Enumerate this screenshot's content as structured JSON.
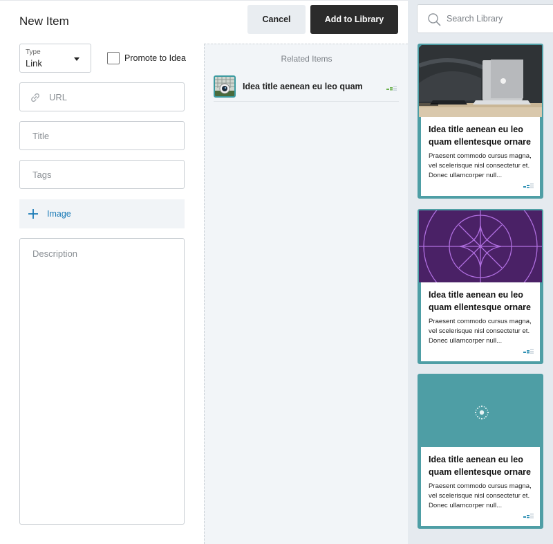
{
  "form": {
    "title": "New Item",
    "type_label": "Type",
    "type_value": "Link",
    "promote_label": "Promote to Idea",
    "promote_checked": false,
    "url_placeholder": "URL",
    "title_placeholder": "Title",
    "tags_placeholder": "Tags",
    "image_label": "Image",
    "description_placeholder": "Description"
  },
  "header": {
    "cancel_label": "Cancel",
    "add_label": "Add to Library"
  },
  "related": {
    "heading": "Related Items",
    "items": [
      {
        "title": "Idea title aenean eu leo quam",
        "icon": "signal-bars-icon"
      }
    ]
  },
  "library": {
    "search_placeholder": "Search Library",
    "cards": [
      {
        "title": "Idea title aenean eu leo quam ellentesque ornare",
        "description": "Praesent commodo cursus magna, vel scelerisque nisl consectetur et. Donec ullamcorper null...",
        "media": "laptop-photo"
      },
      {
        "title": "Idea title aenean eu leo quam ellentesque ornare",
        "description": "Praesent commodo cursus magna, vel scelerisque nisl consectetur et. Donec ullamcorper null...",
        "media": "purple-compass-pattern"
      },
      {
        "title": "Idea title aenean eu leo quam ellentesque ornare",
        "description": "Praesent commodo cursus magna, vel scelerisque nisl consectetur et. Donec ullamcorper null...",
        "media": "teal-sparkle-placeholder"
      }
    ]
  },
  "colors": {
    "accent_teal": "#4e9ea5",
    "link_blue": "#1b7bb7",
    "primary_button": "#2b2b2b",
    "purple": "#4a2166"
  }
}
